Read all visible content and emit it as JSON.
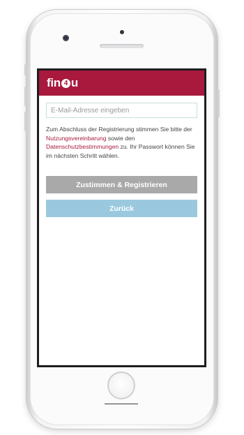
{
  "app": {
    "logo_prefix": "fin",
    "logo_digit": "4",
    "logo_suffix": "u"
  },
  "form": {
    "email_placeholder": "E-Mail-Adresse eingeben",
    "email_value": ""
  },
  "notice": {
    "text_before": "Zum Abschluss der Registrierung stimmen Sie bitte der ",
    "link_terms": "Nutzungsvereinbarung",
    "text_middle": " sowie den ",
    "link_privacy": "Datenschutzbestimmungen",
    "text_after": " zu. Ihr Passwort können Sie im nächsten Schritt wählen."
  },
  "buttons": {
    "register_label": "Zustimmen & Registrieren",
    "back_label": "Zurück"
  },
  "colors": {
    "brand": "#a8193d",
    "register_button": "#a9a9a9",
    "back_button": "#9ac9df"
  }
}
